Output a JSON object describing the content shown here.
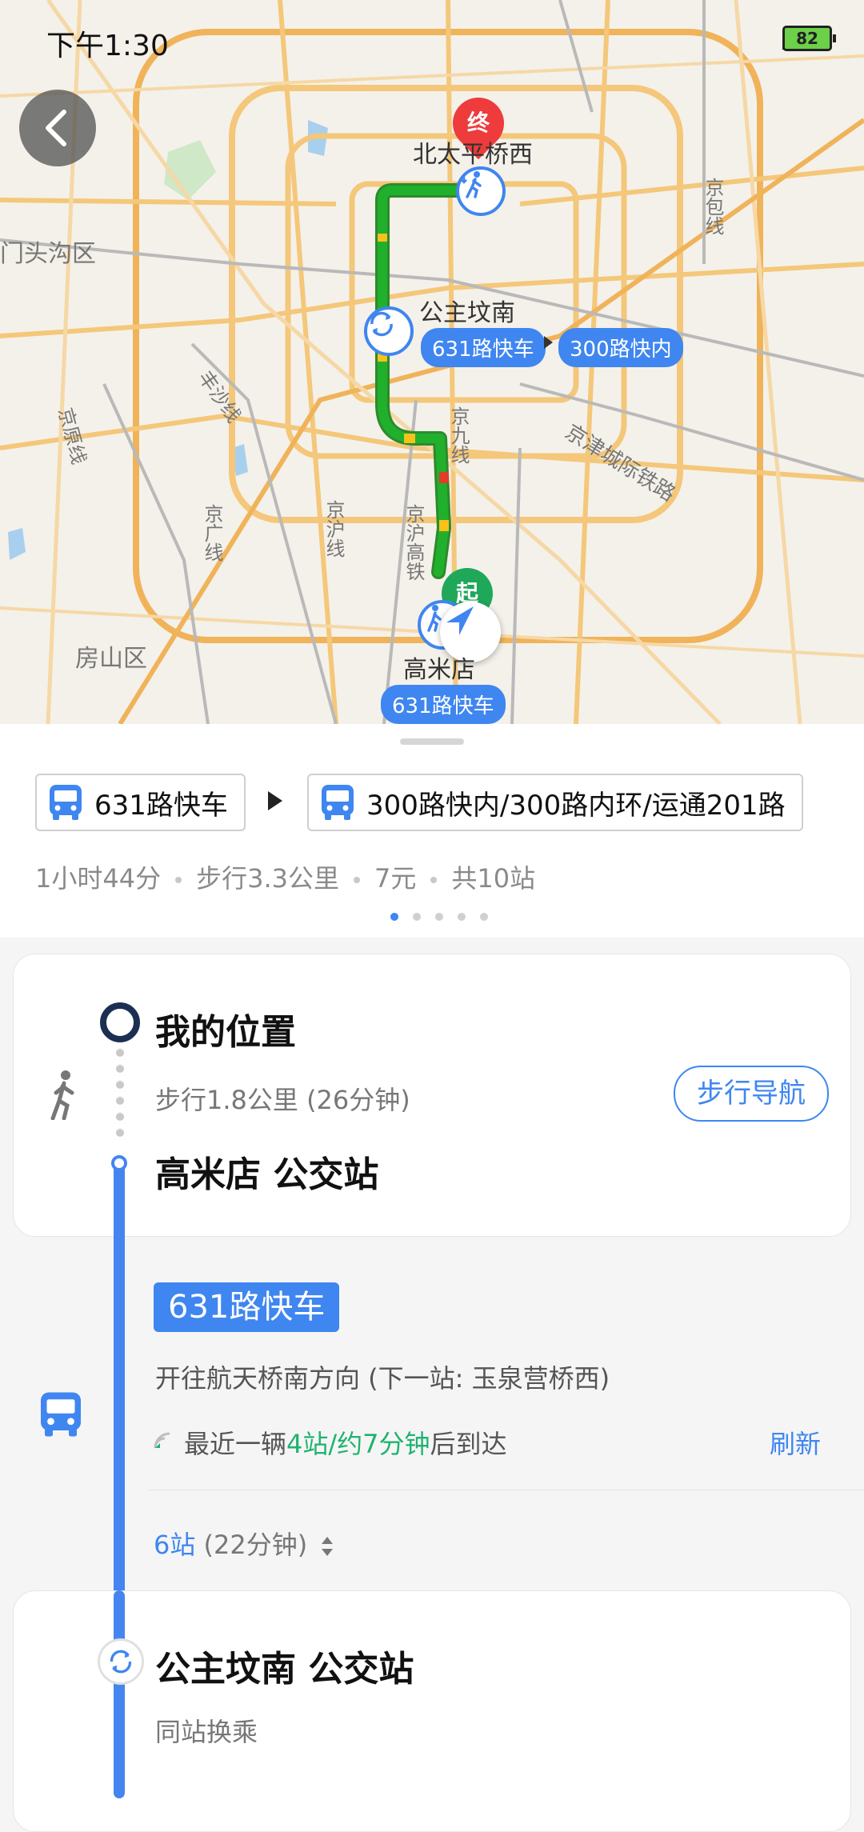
{
  "status_bar": {
    "time": "下午1:30",
    "battery": "82"
  },
  "map": {
    "end_marker": "终",
    "start_marker": "起",
    "labels": {
      "end_station": "北太平桥西",
      "transfer_station": "公主坟南",
      "start_station": "高米店",
      "mentougou": "门头沟区",
      "fangshan": "房山区",
      "jingbao": "京包线",
      "jinjin": "京津城际铁路",
      "fengsha": "丰沙线",
      "jingyuan": "京原线",
      "jingjiu": "京九线",
      "jinghugaotie": "京沪高铁",
      "jinghu": "京沪线",
      "jingguang": "京广线"
    },
    "route_pills": {
      "transfer_first": "631路快车",
      "transfer_second": "300路快内",
      "start_line": "631路快车"
    }
  },
  "summary": {
    "first_line": "631路快车",
    "second_line": "300路快内/300路内环/运通201路",
    "duration": "1小时44分",
    "walk": "步行3.3公里",
    "fare": "7元",
    "stops": "共10站"
  },
  "steps": {
    "origin": "我的位置",
    "walk_desc": "步行1.8公里 (26分钟)",
    "walk_nav": "步行导航",
    "boarding_station": "高米店 公交站",
    "line_name": "631路快车",
    "direction": "开往航天桥南方向 (下一站: 玉泉营桥西)",
    "arrival_prefix": "最近一辆",
    "arrival_highlight": "4站/约7分钟",
    "arrival_suffix": "后到达",
    "refresh": "刷新",
    "stop_count": "6站",
    "stop_duration": "(22分钟)",
    "transfer_station": "公主坟南 公交站",
    "transfer_note": "同站换乘"
  },
  "colors": {
    "accent": "#3f86f0",
    "route_green": "#1fa82e",
    "highlight_green": "#1fb36e"
  }
}
